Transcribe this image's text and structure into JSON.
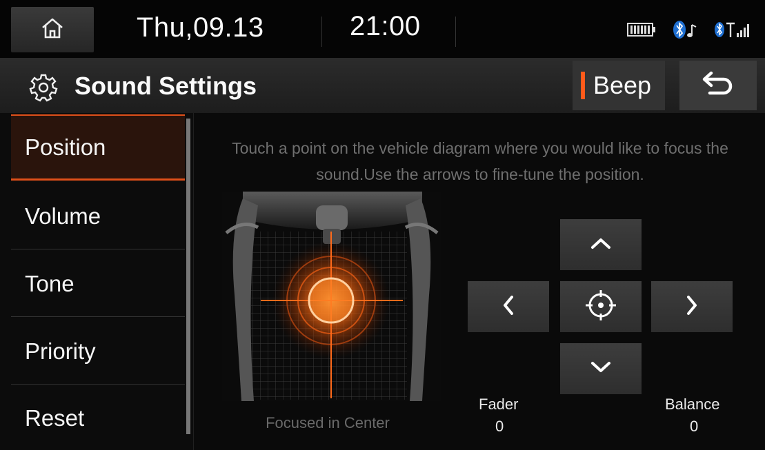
{
  "status": {
    "date": "Thu,09.13",
    "time": "21:00",
    "icons": [
      "battery-icon",
      "bluetooth-audio-icon",
      "bluetooth-signal-icon"
    ]
  },
  "header": {
    "title": "Sound Settings",
    "beep_label": "Beep"
  },
  "sidebar": {
    "items": [
      {
        "label": "Position",
        "active": true
      },
      {
        "label": "Volume"
      },
      {
        "label": "Tone"
      },
      {
        "label": "Priority"
      },
      {
        "label": "Reset"
      }
    ]
  },
  "main": {
    "instruction": "Touch a point on the vehicle diagram where you would like to focus the sound.Use the arrows to fine-tune the position.",
    "focus_status": "Focused in Center",
    "fader": {
      "label": "Fader",
      "value": "0"
    },
    "balance": {
      "label": "Balance",
      "value": "0"
    }
  },
  "colors": {
    "accent": "#ff5a1a",
    "active_bg": "#2a140c",
    "background": "#0a0a0a"
  }
}
